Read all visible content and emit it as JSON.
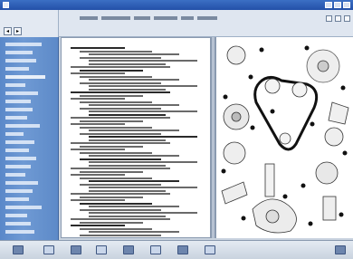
{
  "window": {
    "title_bar_text": "",
    "app_icon": "app-icon",
    "window_buttons": [
      "minimize-icon",
      "maximize-icon",
      "close-icon"
    ]
  },
  "left_toolbar": {
    "buttons": [
      "back-icon",
      "forward-icon"
    ]
  },
  "sidebar": {
    "item_count": 24,
    "selected_index": 4
  },
  "doc_header": {
    "breadcrumb": "",
    "icons": [
      "print-icon",
      "zoom-icon",
      "settings-icon"
    ]
  },
  "text_pane": {
    "heading": "",
    "line_count": 60
  },
  "diagram": {
    "kind": "timing-belt-exploded-view"
  },
  "bottom_toolbar": {
    "buttons": [
      "first-page-icon",
      "prev-page-icon",
      "next-page-icon",
      "last-page-icon",
      "print-icon",
      "zoom-in-icon",
      "zoom-out-icon",
      "car-icon",
      "help-icon"
    ]
  },
  "colors": {
    "accent": "#2350a8",
    "sidebar": "#6f9ad4"
  }
}
